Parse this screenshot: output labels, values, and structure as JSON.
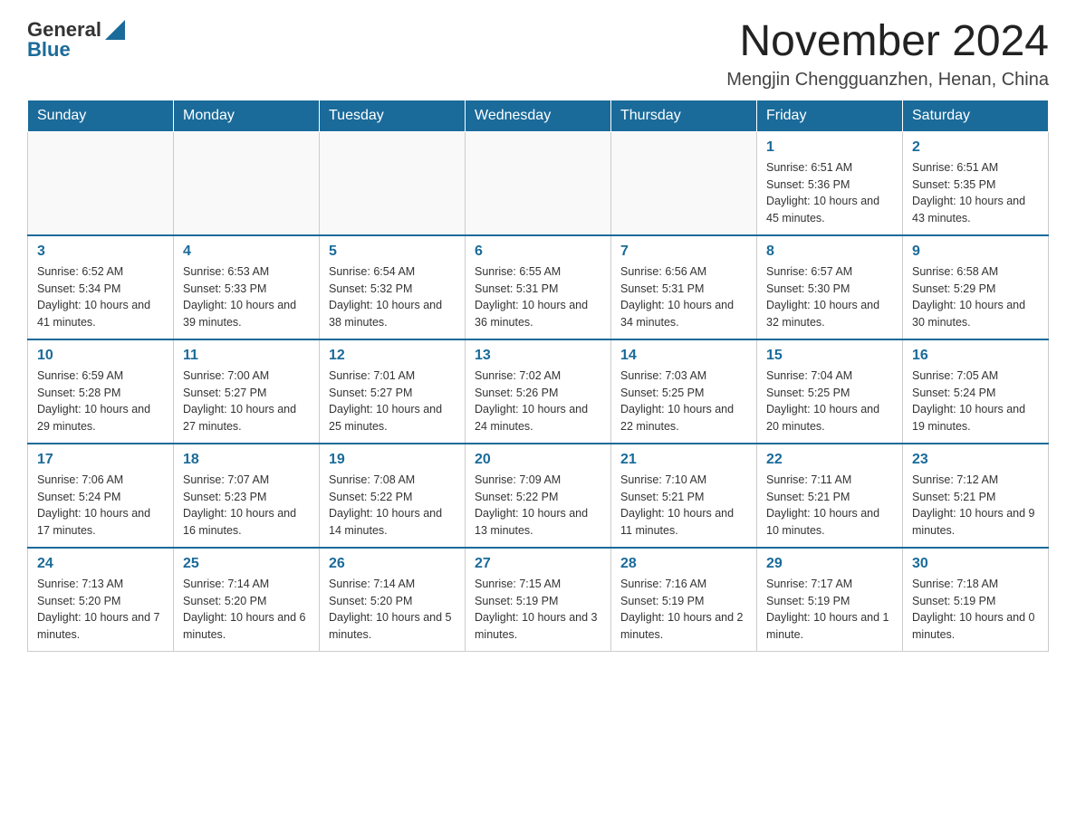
{
  "header": {
    "logo_general": "General",
    "logo_blue": "Blue",
    "month_title": "November 2024",
    "location": "Mengjin Chengguanzhen, Henan, China"
  },
  "days_of_week": [
    "Sunday",
    "Monday",
    "Tuesday",
    "Wednesday",
    "Thursday",
    "Friday",
    "Saturday"
  ],
  "weeks": [
    [
      {
        "day": "",
        "info": ""
      },
      {
        "day": "",
        "info": ""
      },
      {
        "day": "",
        "info": ""
      },
      {
        "day": "",
        "info": ""
      },
      {
        "day": "",
        "info": ""
      },
      {
        "day": "1",
        "info": "Sunrise: 6:51 AM\nSunset: 5:36 PM\nDaylight: 10 hours and 45 minutes."
      },
      {
        "day": "2",
        "info": "Sunrise: 6:51 AM\nSunset: 5:35 PM\nDaylight: 10 hours and 43 minutes."
      }
    ],
    [
      {
        "day": "3",
        "info": "Sunrise: 6:52 AM\nSunset: 5:34 PM\nDaylight: 10 hours and 41 minutes."
      },
      {
        "day": "4",
        "info": "Sunrise: 6:53 AM\nSunset: 5:33 PM\nDaylight: 10 hours and 39 minutes."
      },
      {
        "day": "5",
        "info": "Sunrise: 6:54 AM\nSunset: 5:32 PM\nDaylight: 10 hours and 38 minutes."
      },
      {
        "day": "6",
        "info": "Sunrise: 6:55 AM\nSunset: 5:31 PM\nDaylight: 10 hours and 36 minutes."
      },
      {
        "day": "7",
        "info": "Sunrise: 6:56 AM\nSunset: 5:31 PM\nDaylight: 10 hours and 34 minutes."
      },
      {
        "day": "8",
        "info": "Sunrise: 6:57 AM\nSunset: 5:30 PM\nDaylight: 10 hours and 32 minutes."
      },
      {
        "day": "9",
        "info": "Sunrise: 6:58 AM\nSunset: 5:29 PM\nDaylight: 10 hours and 30 minutes."
      }
    ],
    [
      {
        "day": "10",
        "info": "Sunrise: 6:59 AM\nSunset: 5:28 PM\nDaylight: 10 hours and 29 minutes."
      },
      {
        "day": "11",
        "info": "Sunrise: 7:00 AM\nSunset: 5:27 PM\nDaylight: 10 hours and 27 minutes."
      },
      {
        "day": "12",
        "info": "Sunrise: 7:01 AM\nSunset: 5:27 PM\nDaylight: 10 hours and 25 minutes."
      },
      {
        "day": "13",
        "info": "Sunrise: 7:02 AM\nSunset: 5:26 PM\nDaylight: 10 hours and 24 minutes."
      },
      {
        "day": "14",
        "info": "Sunrise: 7:03 AM\nSunset: 5:25 PM\nDaylight: 10 hours and 22 minutes."
      },
      {
        "day": "15",
        "info": "Sunrise: 7:04 AM\nSunset: 5:25 PM\nDaylight: 10 hours and 20 minutes."
      },
      {
        "day": "16",
        "info": "Sunrise: 7:05 AM\nSunset: 5:24 PM\nDaylight: 10 hours and 19 minutes."
      }
    ],
    [
      {
        "day": "17",
        "info": "Sunrise: 7:06 AM\nSunset: 5:24 PM\nDaylight: 10 hours and 17 minutes."
      },
      {
        "day": "18",
        "info": "Sunrise: 7:07 AM\nSunset: 5:23 PM\nDaylight: 10 hours and 16 minutes."
      },
      {
        "day": "19",
        "info": "Sunrise: 7:08 AM\nSunset: 5:22 PM\nDaylight: 10 hours and 14 minutes."
      },
      {
        "day": "20",
        "info": "Sunrise: 7:09 AM\nSunset: 5:22 PM\nDaylight: 10 hours and 13 minutes."
      },
      {
        "day": "21",
        "info": "Sunrise: 7:10 AM\nSunset: 5:21 PM\nDaylight: 10 hours and 11 minutes."
      },
      {
        "day": "22",
        "info": "Sunrise: 7:11 AM\nSunset: 5:21 PM\nDaylight: 10 hours and 10 minutes."
      },
      {
        "day": "23",
        "info": "Sunrise: 7:12 AM\nSunset: 5:21 PM\nDaylight: 10 hours and 9 minutes."
      }
    ],
    [
      {
        "day": "24",
        "info": "Sunrise: 7:13 AM\nSunset: 5:20 PM\nDaylight: 10 hours and 7 minutes."
      },
      {
        "day": "25",
        "info": "Sunrise: 7:14 AM\nSunset: 5:20 PM\nDaylight: 10 hours and 6 minutes."
      },
      {
        "day": "26",
        "info": "Sunrise: 7:14 AM\nSunset: 5:20 PM\nDaylight: 10 hours and 5 minutes."
      },
      {
        "day": "27",
        "info": "Sunrise: 7:15 AM\nSunset: 5:19 PM\nDaylight: 10 hours and 3 minutes."
      },
      {
        "day": "28",
        "info": "Sunrise: 7:16 AM\nSunset: 5:19 PM\nDaylight: 10 hours and 2 minutes."
      },
      {
        "day": "29",
        "info": "Sunrise: 7:17 AM\nSunset: 5:19 PM\nDaylight: 10 hours and 1 minute."
      },
      {
        "day": "30",
        "info": "Sunrise: 7:18 AM\nSunset: 5:19 PM\nDaylight: 10 hours and 0 minutes."
      }
    ]
  ]
}
